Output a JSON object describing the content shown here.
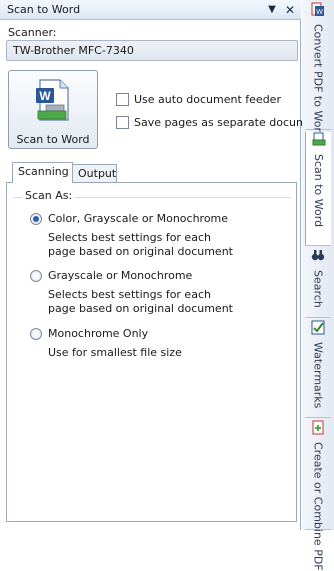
{
  "panel": {
    "title": "Scan to Word",
    "dropdown_glyph": "▼",
    "close_glyph": "✕"
  },
  "scanner": {
    "label": "Scanner:",
    "value": "TW-Brother MFC-7340"
  },
  "action_button": {
    "label": "Scan to Word",
    "icon": "word-scan-icon"
  },
  "options": {
    "auto_feeder": {
      "label": "Use auto document feeder",
      "checked": false
    },
    "separate_docs": {
      "label": "Save pages as separate documents",
      "checked": false
    }
  },
  "tabs": [
    {
      "label": "Scanning",
      "active": true
    },
    {
      "label": "Output",
      "active": false
    }
  ],
  "scan_as": {
    "legend": "Scan As:",
    "options": [
      {
        "label": "Color, Grayscale or Monochrome",
        "selected": true,
        "desc1": "Selects best settings for each",
        "desc2": "page based on original document"
      },
      {
        "label": "Grayscale or Monochrome",
        "selected": false,
        "desc1": "Selects best settings for each",
        "desc2": "page based on original document"
      },
      {
        "label": "Monochrome Only",
        "selected": false,
        "desc1": "Use for smallest file size",
        "desc2": ""
      }
    ]
  },
  "side_tabs": [
    {
      "label": "Convert PDF to Word",
      "icon": "convert-pdf-icon"
    },
    {
      "label": "Scan to Word",
      "icon": "scanner-icon",
      "active": true
    },
    {
      "label": "Search",
      "icon": "binoculars-icon"
    },
    {
      "label": "Watermarks",
      "icon": "checkmark-icon"
    },
    {
      "label": "Create or Combine PDF",
      "icon": "combine-pdf-icon"
    }
  ],
  "colors": {
    "accent": "#2a5fb8",
    "word_blue": "#2b5797",
    "pdf_red": "#c8322b"
  }
}
